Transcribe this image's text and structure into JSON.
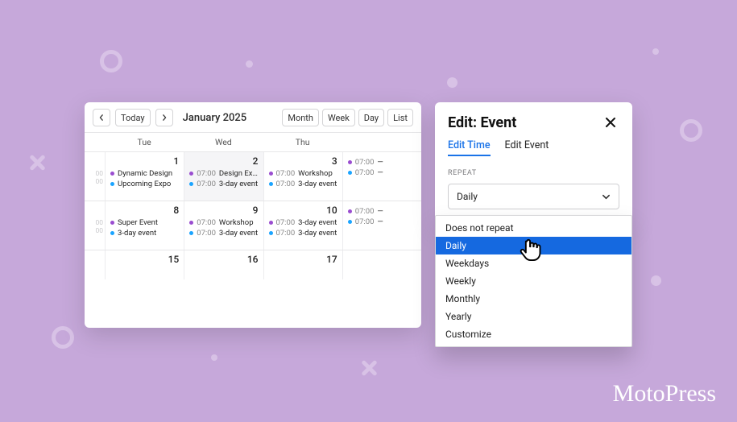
{
  "brand": "MotoPress",
  "calendar": {
    "today_label": "Today",
    "title": "January 2025",
    "views": {
      "month": "Month",
      "week": "Week",
      "day": "Day",
      "list": "List"
    },
    "day_headers": [
      "Tue",
      "Wed",
      "Thu",
      ""
    ],
    "gutter_times": [
      "00",
      "00",
      "00",
      "00"
    ],
    "rows": [
      {
        "days": [
          {
            "num": "1",
            "events": [
              {
                "color": "#9a4dd0",
                "time": "",
                "title": "Dynamic Design"
              },
              {
                "color": "#1aa4ff",
                "time": "",
                "title": "Upcoming Expo"
              }
            ]
          },
          {
            "num": "2",
            "highlight": true,
            "events": [
              {
                "color": "#9a4dd0",
                "time": "07:00",
                "title": "Design Expo"
              },
              {
                "color": "#1aa4ff",
                "time": "07:00",
                "title": "3-day event"
              }
            ]
          },
          {
            "num": "3",
            "events": [
              {
                "color": "#9a4dd0",
                "time": "07:00",
                "title": "Workshop"
              },
              {
                "color": "#1aa4ff",
                "time": "07:00",
                "title": "3-day event"
              }
            ]
          },
          {
            "num": "",
            "events": [
              {
                "color": "#9a4dd0",
                "time": "07:00",
                "title": "—"
              },
              {
                "color": "#1aa4ff",
                "time": "07:00",
                "title": "—"
              }
            ]
          }
        ]
      },
      {
        "days": [
          {
            "num": "8",
            "events": [
              {
                "color": "#9a4dd0",
                "time": "",
                "title": "Super Event"
              },
              {
                "color": "#1aa4ff",
                "time": "",
                "title": "3-day event"
              }
            ]
          },
          {
            "num": "9",
            "events": [
              {
                "color": "#9a4dd0",
                "time": "07:00",
                "title": "Workshop"
              },
              {
                "color": "#1aa4ff",
                "time": "07:00",
                "title": "3-day event"
              }
            ]
          },
          {
            "num": "10",
            "events": [
              {
                "color": "#9a4dd0",
                "time": "07:00",
                "title": "3-day event"
              },
              {
                "color": "#1aa4ff",
                "time": "07:00",
                "title": "3-day event"
              }
            ]
          },
          {
            "num": "",
            "events": [
              {
                "color": "#9a4dd0",
                "time": "07:00",
                "title": "—"
              },
              {
                "color": "#1aa4ff",
                "time": "07:00",
                "title": "—"
              }
            ]
          }
        ]
      },
      {
        "days": [
          {
            "num": "15",
            "events": []
          },
          {
            "num": "16",
            "events": []
          },
          {
            "num": "17",
            "events": []
          },
          {
            "num": "",
            "events": []
          }
        ]
      }
    ]
  },
  "modal": {
    "title": "Edit: Event",
    "tabs": {
      "time": "Edit Time",
      "event": "Edit Event"
    },
    "repeat_label": "REPEAT",
    "repeat_value": "Daily",
    "options": [
      "Does not repeat",
      "Daily",
      "Weekdays",
      "Weekly",
      "Monthly",
      "Yearly",
      "Customize"
    ],
    "selected_index": 1
  },
  "colors": {
    "accent": "#1a73e8",
    "purple_dot": "#9a4dd0",
    "blue_dot": "#1aa4ff"
  }
}
